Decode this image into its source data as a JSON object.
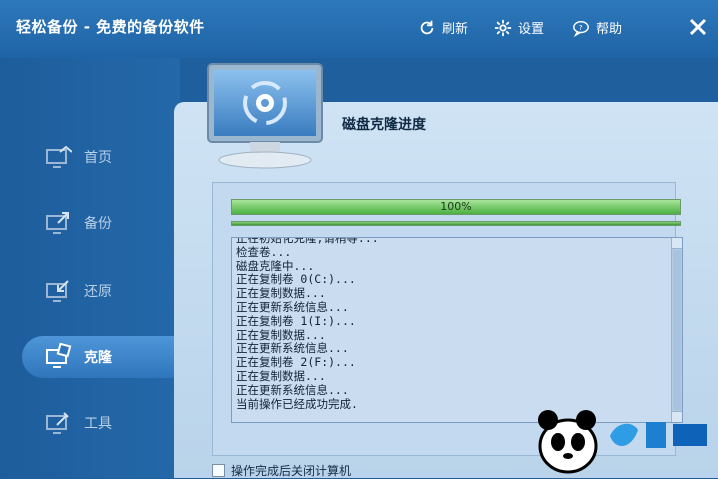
{
  "app_title": "轻松备份 - 免费的备份软件",
  "toolbar": {
    "refresh_label": "刷新",
    "settings_label": "设置",
    "help_label": "帮助"
  },
  "sidebar": {
    "items": [
      {
        "label": "首页"
      },
      {
        "label": "备份"
      },
      {
        "label": "还原"
      },
      {
        "label": "克隆"
      },
      {
        "label": "工具"
      }
    ],
    "active_index": 3
  },
  "panel": {
    "title": "磁盘克隆进度",
    "progress_value": 100,
    "progress_label": "100%",
    "log_lines": [
      "正在初始化克隆,请稍等...",
      "检查卷...",
      "磁盘克隆中...",
      "正在复制卷 0(C:)...",
      "正在复制数据...",
      "正在更新系统信息...",
      "正在复制卷 1(I:)...",
      "正在复制数据...",
      "正在更新系统信息...",
      "正在复制卷 2(F:)...",
      "正在复制数据...",
      "正在更新系统信息...",
      "当前操作已经成功完成."
    ],
    "shutdown_option_label": "操作完成后关闭计算机"
  },
  "colors": {
    "titlebar": "#2d78bb",
    "sidebar": "#1e5d9c",
    "active_nav": "#3f89cf",
    "panel_bg": "#cfe3f4",
    "progress_fill": "#4bb140"
  }
}
